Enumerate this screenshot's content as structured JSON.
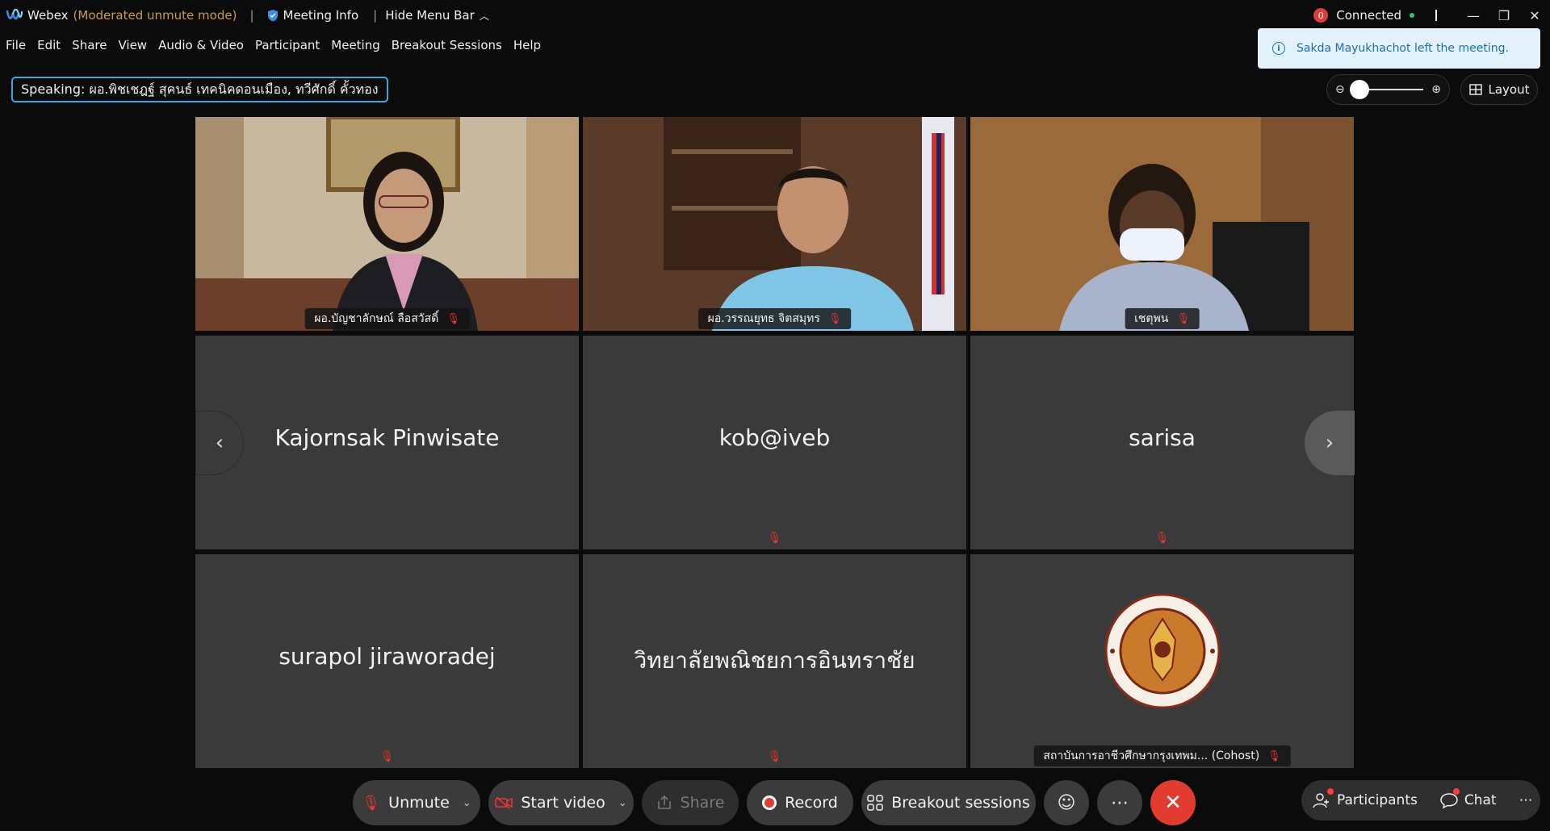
{
  "titlebar": {
    "app": "Webex",
    "mode": "(Moderated unmute mode)",
    "separator": "|",
    "meeting_info": "Meeting Info",
    "hide_menu": "Hide Menu Bar",
    "status_badge": "0",
    "connected": "Connected"
  },
  "menu": [
    "File",
    "Edit",
    "Share",
    "View",
    "Audio & Video",
    "Participant",
    "Meeting",
    "Breakout Sessions",
    "Help"
  ],
  "speaking": "Speaking: ผอ.พิชเชฎฐ์ สุคนธ์ เทคนิคดอนเมือง, ทวีศักดิ์ คั้วทอง",
  "toast": "Sakda Mayukhachot left the meeting.",
  "layout_label": "Layout",
  "tiles": [
    {
      "name": "ผอ.บัญชาลักษณ์ ลือสวัสดิ์"
    },
    {
      "name": "ผอ.วรรณยุทธ จิตสมุทร"
    },
    {
      "name": "เชตุพน"
    },
    {
      "name": "Kajornsak Pinwisate"
    },
    {
      "name": "kob@iveb"
    },
    {
      "name": "sarisa"
    },
    {
      "name": "surapol jiraworadej"
    },
    {
      "name": "วิทยาลัยพณิชยการอินทราชัย"
    },
    {
      "name": "สถาบันการอาชีวศึกษากรุงเทพม... (Cohost)"
    }
  ],
  "controls": {
    "unmute": "Unmute",
    "start_video": "Start video",
    "share": "Share",
    "record": "Record",
    "breakout": "Breakout sessions"
  },
  "right": {
    "participants": "Participants",
    "chat": "Chat"
  },
  "colors": {
    "accent": "#3aa7e0",
    "end_call": "#e23b2f",
    "tile_bg": "#3a3a3a",
    "mode_text": "#c89a4a"
  }
}
